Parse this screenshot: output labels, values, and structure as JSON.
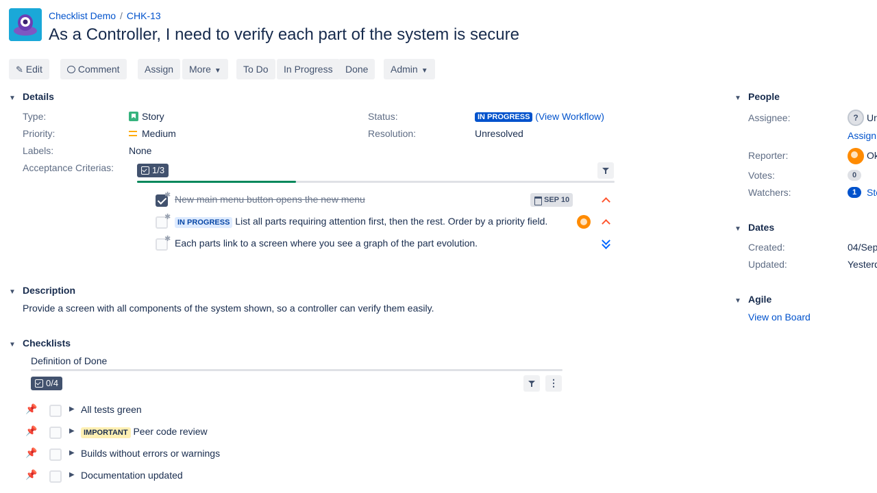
{
  "breadcrumb": {
    "project": "Checklist Demo",
    "separator": "/",
    "issue_key": "CHK-13"
  },
  "title": "As a Controller, I need to verify each part of the system is secure",
  "toolbar": {
    "edit": "Edit",
    "comment": "Comment",
    "assign": "Assign",
    "more": "More",
    "todo": "To Do",
    "in_progress": "In Progress",
    "done": "Done",
    "admin": "Admin"
  },
  "details": {
    "heading": "Details",
    "type_label": "Type:",
    "type_value": "Story",
    "priority_label": "Priority:",
    "priority_value": "Medium",
    "labels_label": "Labels:",
    "labels_value": "None",
    "acceptance_label": "Acceptance Criterias:",
    "status_label": "Status:",
    "status_value": "IN PROGRESS",
    "view_workflow": "(View Workflow)",
    "resolution_label": "Resolution:",
    "resolution_value": "Unresolved"
  },
  "acceptance": {
    "counter": "1/3",
    "progress": 0.333,
    "items": [
      {
        "text": "New main menu button opens the new menu",
        "checked": true,
        "date": "SEP 10",
        "priority": "high"
      },
      {
        "status": "IN PROGRESS",
        "text": "List all parts requiring attention first, then the rest. Order by a priority field.",
        "checked": false,
        "priority": "high"
      },
      {
        "text": "Each parts link to a screen where you see a graph of the part evolution.",
        "checked": false,
        "priority": "lowest"
      }
    ]
  },
  "description": {
    "heading": "Description",
    "text": "Provide a screen with all components of the system shown, so a controller can verify them easily."
  },
  "checklists": {
    "heading": "Checklists",
    "name": "Definition of Done",
    "counter": "0/4",
    "progress": 0,
    "items": [
      {
        "text": "All tests green"
      },
      {
        "tag": "IMPORTANT",
        "text": "Peer code review"
      },
      {
        "text": "Builds without errors or warnings"
      },
      {
        "text": "Documentation updated"
      }
    ]
  },
  "people": {
    "heading": "People",
    "assignee_label": "Assignee:",
    "assignee_value": "Ur",
    "assign_link": "Assign",
    "reporter_label": "Reporter:",
    "reporter_value": "Ok",
    "votes_label": "Votes:",
    "votes_value": "0",
    "watchers_label": "Watchers:",
    "watchers_value": "1",
    "watchers_link": "Sto"
  },
  "dates": {
    "heading": "Dates",
    "created_label": "Created:",
    "created_value": "04/Sep",
    "updated_label": "Updated:",
    "updated_value": "Yesterd"
  },
  "agile": {
    "heading": "Agile",
    "view_on_board": "View on Board"
  },
  "colors": {
    "accent": "#0052cc",
    "progress": "#00875a",
    "priority_high": "#ff5630",
    "priority_low": "#0065ff"
  }
}
